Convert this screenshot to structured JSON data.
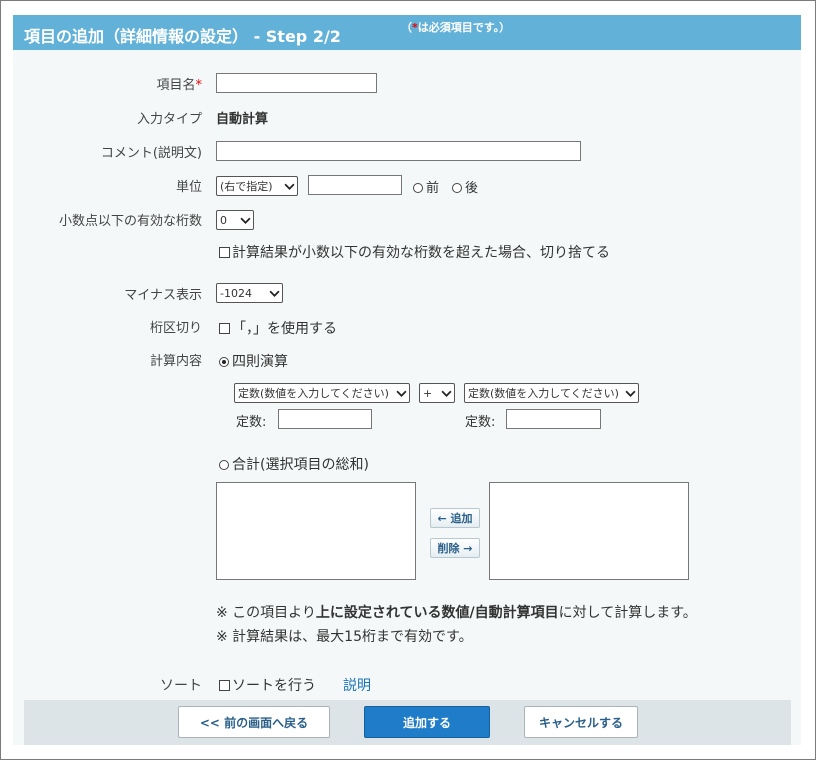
{
  "header": {
    "title": "項目の追加（詳細情報の設定） - Step 2/2",
    "req_note_prefix": "（",
    "req_note_mark": "*",
    "req_note_suffix": "は必須項目です。）"
  },
  "form": {
    "name": {
      "label": "項目名",
      "required_mark": "*",
      "value": ""
    },
    "input_type": {
      "label": "入力タイプ",
      "value": "自動計算"
    },
    "comment": {
      "label": "コメント(説明文)",
      "value": ""
    },
    "unit": {
      "label": "単位",
      "position_select": "(右で指定)",
      "value": "",
      "option_before": "前",
      "option_after": "後"
    },
    "decimals": {
      "label": "小数点以下の有効な桁数",
      "select": "0",
      "truncate_checkbox_label": "計算結果が小数以下の有効な桁数を超えた場合、切り捨てる"
    },
    "negative": {
      "label": "マイナス表示",
      "select": "-1024"
    },
    "separator": {
      "label": "桁区切り",
      "checkbox_label": "「，」を使用する"
    },
    "calc": {
      "label": "計算内容",
      "arith_label": "四則演算",
      "left_select": "定数(数値を入力してください)",
      "operator_select": "+",
      "right_select": "定数(数値を入力してください)",
      "const_label_left": "定数:",
      "const_label_right": "定数:",
      "sum_label": "合計(選択項目の総和)",
      "add_button": "← 追加",
      "remove_button": "削除 →",
      "note1_pre": "※ この項目より",
      "note1_bold": "上に設定されている数値/自動計算項目",
      "note1_post": "に対して計算します。",
      "note2": "※ 計算結果は、最大15桁まで有効です。"
    },
    "sort": {
      "label": "ソート",
      "checkbox_label": "ソートを行う",
      "help_link": "説明"
    }
  },
  "footer": {
    "back_button": "<< 前の画面へ戻る",
    "add_button": "追加する",
    "cancel_button": "キャンセルする"
  }
}
